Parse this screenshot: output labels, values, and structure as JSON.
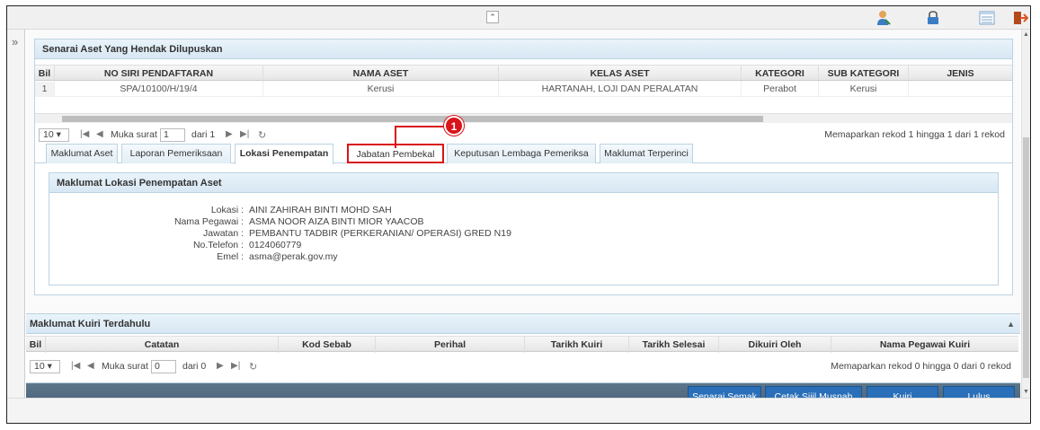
{
  "asset_panel": {
    "title": "Senarai Aset Yang Hendak Dilupuskan",
    "columns": [
      "Bil",
      "NO SIRI PENDAFTARAN",
      "NAMA ASET",
      "KELAS ASET",
      "KATEGORI",
      "SUB KATEGORI",
      "JENIS"
    ],
    "rows": [
      [
        "1",
        "SPA/10100/H/19/4",
        "Kerusi",
        "HARTANAH, LOJI DAN PERALATAN",
        "Perabot",
        "Kerusi",
        ""
      ]
    ],
    "pager": {
      "page_size": "10",
      "page_label": "Muka surat",
      "page_value": "1",
      "of_label": "dari 1",
      "records_info": "Memaparkan rekod 1 hingga 1 dari 1 rekod"
    }
  },
  "tabs": [
    {
      "label": "Maklumat Aset",
      "active": false
    },
    {
      "label": "Laporan Pemeriksaan",
      "active": false
    },
    {
      "label": "Lokasi Penempatan",
      "active": true
    },
    {
      "label": "Jabatan Pembekal",
      "active": false,
      "highlighted": true
    },
    {
      "label": "Keputusan Lembaga Pemeriksa",
      "active": false
    },
    {
      "label": "Maklumat Terperinci",
      "active": false
    }
  ],
  "callout": {
    "number": "1"
  },
  "location_panel": {
    "title": "Maklumat Lokasi Penempatan Aset",
    "fields": [
      {
        "label": "Lokasi :",
        "value": "AINI ZAHIRAH BINTI MOHD SAH"
      },
      {
        "label": "Nama Pegawai :",
        "value": "ASMA NOOR AIZA BINTI MIOR YAACOB"
      },
      {
        "label": "Jawatan :",
        "value": "PEMBANTU TADBIR (PERKERANIAN/ OPERASI) GRED N19"
      },
      {
        "label": "No.Telefon :",
        "value": "0124060779"
      },
      {
        "label": "Emel :",
        "value": "asma@perak.gov.my"
      }
    ]
  },
  "query_panel": {
    "title": "Maklumat Kuiri Terdahulu",
    "columns": [
      "Bil",
      "Catatan",
      "Kod Sebab",
      "Perihal",
      "Tarikh Kuiri",
      "Tarikh Selesai",
      "Dikuiri Oleh",
      "Nama Pegawai Kuiri"
    ],
    "pager": {
      "page_size": "10",
      "page_label": "Muka surat",
      "page_value": "0",
      "of_label": "dari 0",
      "records_info": "Memaparkan rekod 0 hingga 0 dari 0 rekod"
    }
  },
  "footer_buttons": {
    "checklist": "Senarai Semak",
    "print_certificate": "Cetak Sijil Musnah",
    "query": "Kuiri",
    "approve": "Lulus"
  },
  "icons": {
    "collapse": "double-chevron-up-icon",
    "expand": "double-chevron-right-icon",
    "user": "user-icon",
    "lock": "lock-icon",
    "list": "list-icon",
    "logout": "logout-icon"
  },
  "colors": {
    "highlight": "#d9141b",
    "button": "#2a6fb8",
    "footer": "#4f687f"
  }
}
